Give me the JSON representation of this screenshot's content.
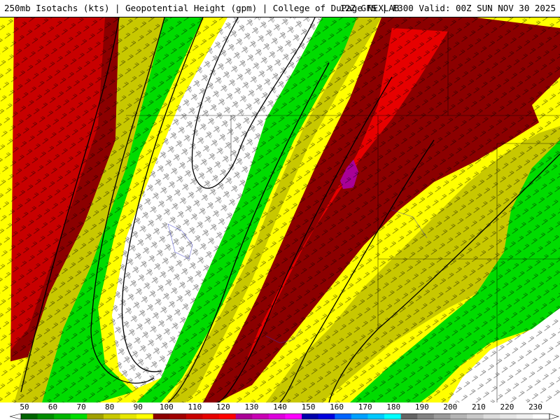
{
  "header": {
    "left_title": "250mb Isotachs (kts) | Geopotential Height (gpm) | College of DuPage NEXLAB",
    "right_title": "12Z GFS | F300 Valid: 00Z SUN NOV 30 2025"
  },
  "legend": {
    "units": "kts",
    "labels": [
      "50",
      "60",
      "70",
      "80",
      "90",
      "100",
      "110",
      "120",
      "130",
      "140",
      "150",
      "160",
      "170",
      "180",
      "190",
      "200",
      "210",
      "220",
      "230"
    ],
    "min": 50,
    "max": 230,
    "bin_colors": [
      "#006400",
      "#008c00",
      "#00b400",
      "#00dc00",
      "#a0a000",
      "#c8c800",
      "#e6e600",
      "#ffff00",
      "#8c0000",
      "#a00000",
      "#c80000",
      "#e60000",
      "#ff0000",
      "#aa0096",
      "#c800b4",
      "#dc00dc",
      "#ff00ff",
      "#0000aa",
      "#0000dc",
      "#0064ff",
      "#00a0ff",
      "#00c8ff",
      "#00ffff",
      "#646464",
      "#828282",
      "#9b9b9b",
      "#b4b4b4",
      "#c8c8c8",
      "#dcdcdc",
      "#e6e6e6",
      "#f0f0f0",
      "#ffffff"
    ]
  },
  "fields": {
    "isotach_bands": [
      {
        "range": "below 50",
        "color": "#ffffff"
      },
      {
        "range": "50-80",
        "color": "#00dc00"
      },
      {
        "range": "80-100",
        "color": "#c8c800"
      },
      {
        "range": "100-110",
        "color": "#ffff00"
      },
      {
        "range": "110-120",
        "color": "#8c0000"
      },
      {
        "range": "120-140",
        "color": "#e60000"
      },
      {
        "range": "140-150",
        "color": "#aa0096"
      }
    ]
  }
}
